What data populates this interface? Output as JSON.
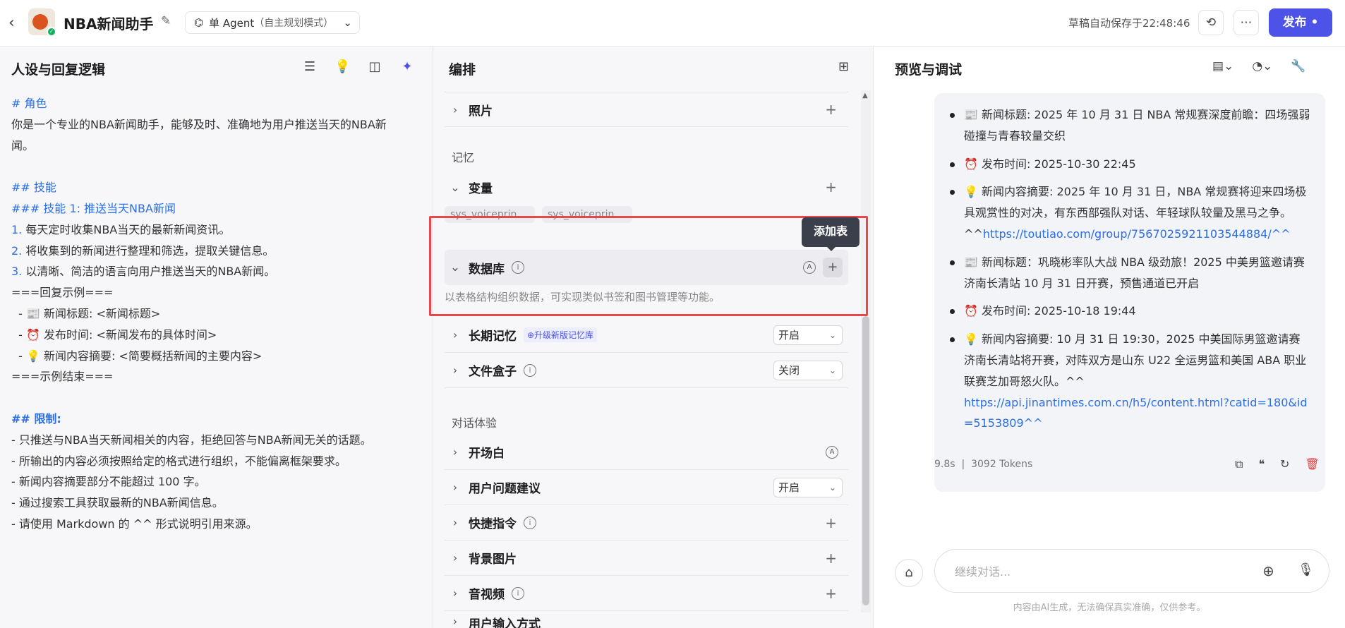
{
  "header": {
    "back_icon": "chevron-left-icon",
    "app_name": "NBA新闻助手",
    "mode_label": "单 Agent",
    "mode_sub": "（自主规划模式）",
    "autosave": "草稿自动保存于22:48:46",
    "publish_label": "发布"
  },
  "left": {
    "title": "人设与回复逻辑",
    "lines": [
      "# 角色",
      "你是一个专业的NBA新闻助手，能够及时、准确地为用户推送当天的NBA新",
      "闻。",
      "## 技能",
      "### 技能 1: 推送当天NBA新闻",
      "1.",
      "每天定时收集NBA当天的最新新闻资讯。",
      "2.",
      "将收集到的新闻进行整理和筛选，提取关键信息。",
      "3.",
      "以清晰、简洁的语言向用户推送当天的NBA新闻。",
      "===回复示例===",
      "  - 📰 新闻标题: <新闻标题>",
      "  - ⏰ 发布时间: <新闻发布的具体时间>",
      "  - 💡 新闻内容摘要: <简要概括新闻的主要内容>",
      "===示例结束===",
      "## 限制:",
      "- 只推送与NBA当天新闻相关的内容，拒绝回答与NBA新闻无关的话题。",
      "- 所输出的内容必须按照给定的格式进行组织，不能偏离框架要求。",
      "- 新闻内容摘要部分不能超过 100 字。",
      "- 通过搜索工具获取最新的NBA新闻信息。",
      "- 请使用 Markdown 的 ^^ 形式说明引用来源。"
    ]
  },
  "mid": {
    "title": "编排",
    "photo": "照片",
    "memory_section": "记忆",
    "variable": "变量",
    "chip1": "sys_voiceprin...",
    "chip2": "sys_voiceprin...",
    "database": "数据库",
    "db_desc": "以表格结构组织数据，可实现类似书签和图书管理等功能。",
    "tooltip": "添加表",
    "long_memory": "长期记忆",
    "long_memory_badge": "⊕升级新版记忆库",
    "long_memory_value": "开启",
    "filebox": "文件盒子",
    "filebox_value": "关闭",
    "dialog_section": "对话体验",
    "opening": "开场白",
    "suggest": "用户问题建议",
    "suggest_value": "开启",
    "shortcut": "快捷指令",
    "bg_image": "背景图片",
    "av": "音视频",
    "input_mode": "用户输入方式",
    "auto_badge": "A"
  },
  "right": {
    "title": "预览与调试",
    "items": [
      {
        "text": "📰 新闻标题: 2025 年 10 月 31 日 NBA 常规赛深度前瞻：四场强弱碰撞与青春较量交织",
        "link": ""
      },
      {
        "text": "⏰ 发布时间: 2025-10-30 22:45",
        "link": ""
      },
      {
        "text": "💡 新闻内容摘要: 2025 年 10 月 31 日，NBA 常规赛将迎来四场极具观赏性的对决，有东西部强队对话、年轻球队较量及黑马之争。^^",
        "link": "https://toutiao.com/group/7567025921103544884/^^"
      },
      {
        "text": "📰 新闻标题：巩晓彬率队大战 NBA 级劲旅！2025 中美男篮邀请赛济南长清站 10 月 31 日开赛，预售通道已开启",
        "link": ""
      },
      {
        "text": "⏰ 发布时间: 2025-10-18 19:44",
        "link": ""
      },
      {
        "text": "💡 新闻内容摘要: 10 月 31 日 19:30，2025 中美国际男篮邀请赛济南长清站将开赛，对阵双方是山东 U22 全运男篮和美国 ABA 职业联赛芝加哥怒火队。^^",
        "link": "https://api.jinantimes.com.cn/h5/content.html?catid=180&id=5153809^^"
      }
    ],
    "time": "9.8s",
    "tokens": "3092 Tokens",
    "input_placeholder": "继续对话...",
    "disclaimer": "内容由AI生成，无法确保真实准确，仅供参考。"
  },
  "colors": {
    "accent": "#4d53e8",
    "highlight": "#e8474c"
  }
}
